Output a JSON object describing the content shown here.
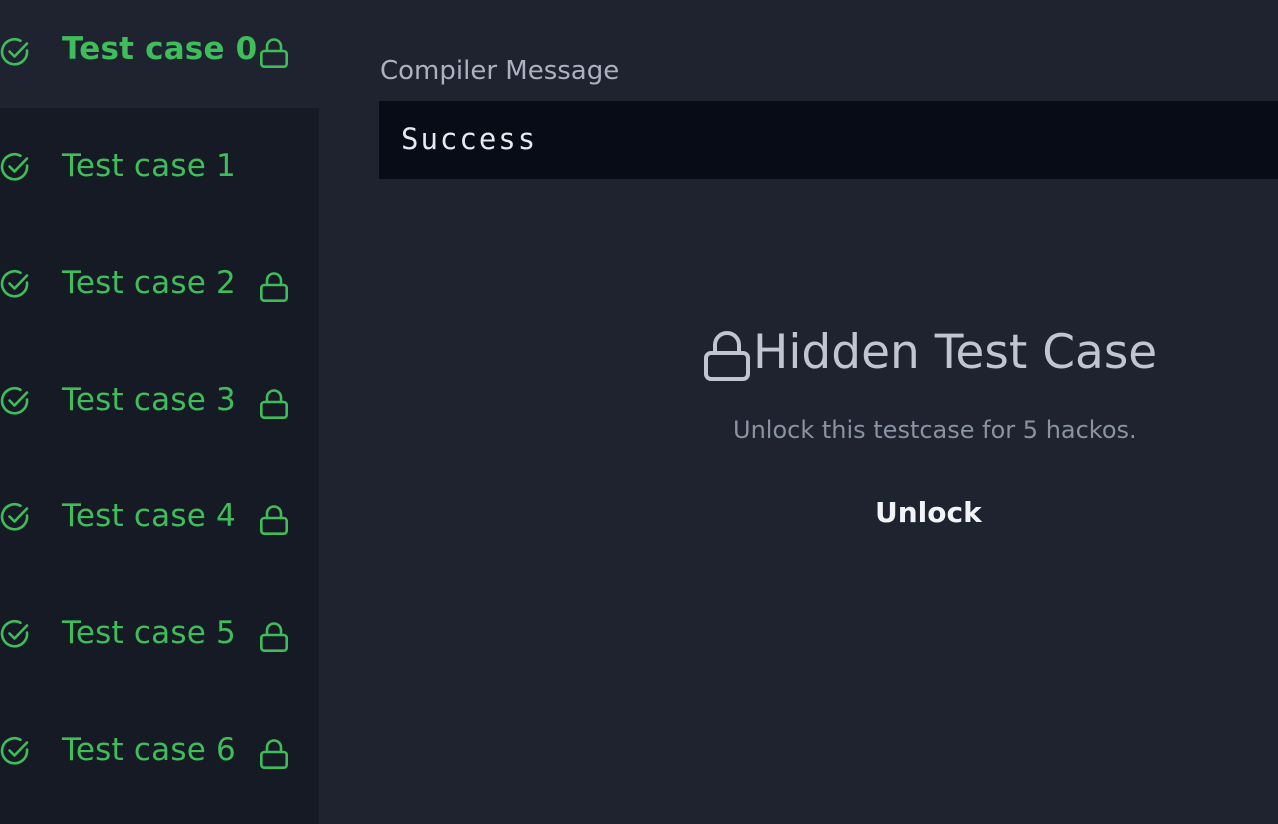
{
  "sidebar": {
    "items": [
      {
        "label": "Test case 0",
        "locked": true,
        "passed": true,
        "active": true
      },
      {
        "label": "Test case 1",
        "locked": false,
        "passed": true,
        "active": false
      },
      {
        "label": "Test case 2",
        "locked": true,
        "passed": true,
        "active": false
      },
      {
        "label": "Test case 3",
        "locked": true,
        "passed": true,
        "active": false
      },
      {
        "label": "Test case 4",
        "locked": true,
        "passed": true,
        "active": false
      },
      {
        "label": "Test case 5",
        "locked": true,
        "passed": true,
        "active": false
      },
      {
        "label": "Test case 6",
        "locked": true,
        "passed": true,
        "active": false
      }
    ]
  },
  "main": {
    "compiler_label": "Compiler Message",
    "compiler_output": "Success",
    "hidden_title": "Hidden Test Case",
    "hidden_subtitle": "Unlock this testcase for 5 hackos.",
    "unlock_label": "Unlock"
  },
  "icons": {
    "check": "check-circle-icon",
    "lock": "lock-icon"
  },
  "colors": {
    "success_green": "#3fbd5a",
    "sidebar_bg": "#151a24",
    "main_bg": "#1f2330",
    "output_bg": "#070c17"
  }
}
